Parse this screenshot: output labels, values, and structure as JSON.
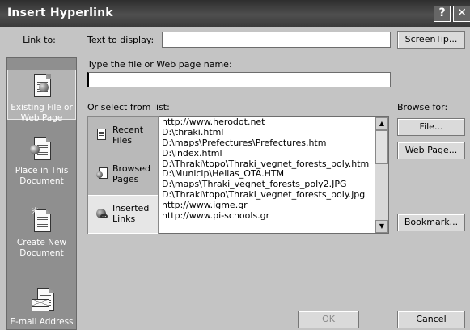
{
  "window": {
    "title": "Insert Hyperlink",
    "help_glyph": "?",
    "close_glyph": "✕"
  },
  "link_to": {
    "label": "Link to:",
    "places": [
      {
        "line1": "Existing File or",
        "line2": "Web Page",
        "icon": "existing-file-icon",
        "active": true
      },
      {
        "line1": "Place in This",
        "line2": "Document",
        "icon": "place-in-document-icon",
        "active": false
      },
      {
        "line1": "Create New",
        "line2": "Document",
        "icon": "create-new-document-icon",
        "active": false
      },
      {
        "line1": "E-mail Address",
        "line2": "",
        "icon": "email-icon",
        "active": false
      }
    ]
  },
  "text_to_display": {
    "label": "Text to display:",
    "value": ""
  },
  "screentip_button": "ScreenTip...",
  "web_name": {
    "label": "Type the file or Web page name:",
    "value": ""
  },
  "select_from_list": {
    "label": "Or select from list:"
  },
  "browse_for": {
    "label": "Browse for:",
    "file_button": "File...",
    "web_page_button": "Web Page..."
  },
  "list_tabs": [
    {
      "line1": "Recent",
      "line2": "Files",
      "icon": "recent-files-icon",
      "active": false
    },
    {
      "line1": "Browsed",
      "line2": "Pages",
      "icon": "browsed-pages-icon",
      "active": false
    },
    {
      "line1": "Inserted",
      "line2": "Links",
      "icon": "inserted-links-icon",
      "active": true
    }
  ],
  "urls": [
    "http://www.herodot.net",
    "D:\\thraki.html",
    "D:\\maps\\Prefectures\\Prefectures.htm",
    "D:\\index.html",
    "D:\\Thraki\\topo\\Thraki_vegnet_forests_poly.htm",
    "D:\\Municip\\Hellas_OTA.HTM",
    "D:\\maps\\Thraki_vegnet_forests_poly2.JPG",
    "D:\\Thraki\\topo\\Thraki_vegnet_forests_poly.jpg",
    "http://www.igme.gr",
    "http://www.pi-schools.gr"
  ],
  "bookmark_button": "Bookmark...",
  "ok_button": "OK",
  "cancel_button": "Cancel"
}
